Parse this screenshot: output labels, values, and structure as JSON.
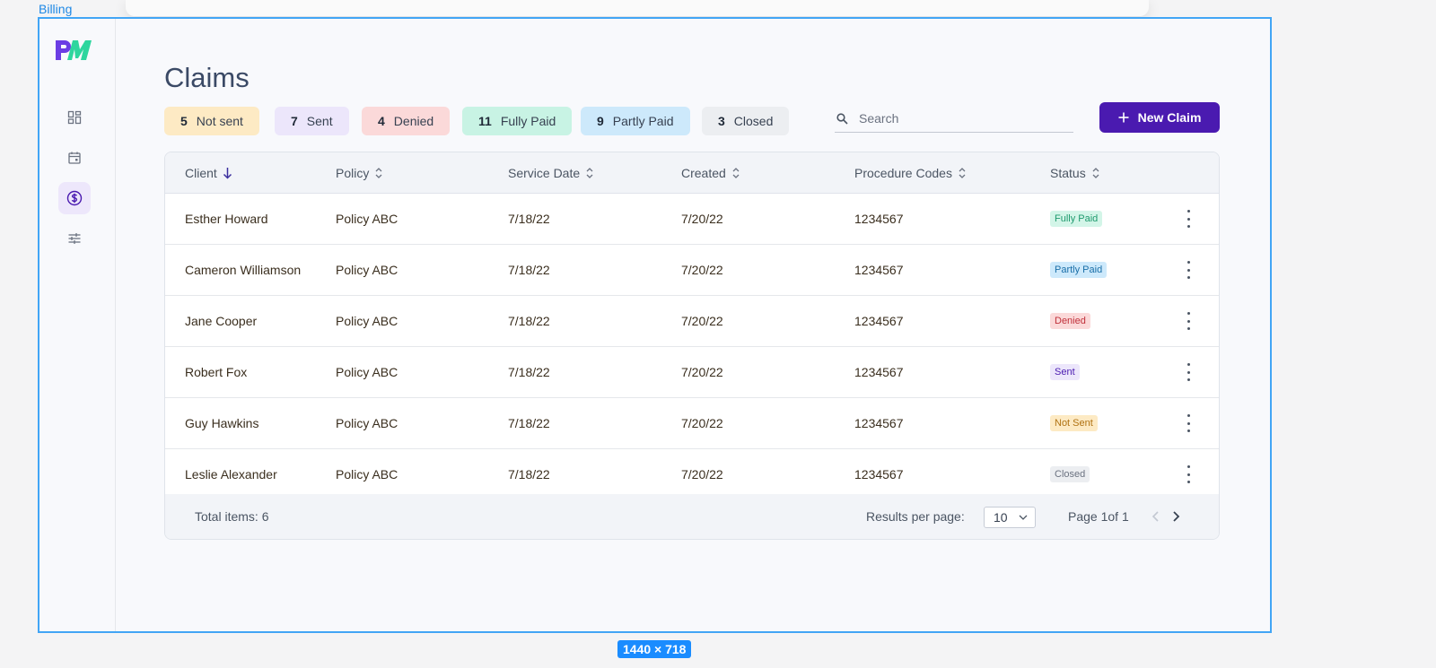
{
  "frame_label": "Billing",
  "size_badge": "1440 × 718",
  "page_title": "Claims",
  "chips": [
    {
      "count": "5",
      "label": "Not sent",
      "bg": "#fdeac4"
    },
    {
      "count": "7",
      "label": "Sent",
      "bg": "#ece6fb"
    },
    {
      "count": "4",
      "label": "Denied",
      "bg": "#fbd9d9"
    },
    {
      "count": "11",
      "label": "Fully Paid",
      "bg": "#c8f3e4"
    },
    {
      "count": "9",
      "label": "Partly Paid",
      "bg": "#cde9fb"
    },
    {
      "count": "3",
      "label": "Closed",
      "bg": "#eceef1"
    }
  ],
  "search": {
    "placeholder": "Search"
  },
  "new_claim_label": "New Claim",
  "table": {
    "columns": [
      "Client",
      "Policy",
      "Service Date",
      "Created",
      "Procedure Codes",
      "Status"
    ],
    "rows": [
      {
        "client": "Esther Howard",
        "policy": "Policy ABC",
        "service_date": "7/18/22",
        "created": "7/20/22",
        "codes": "1234567",
        "status": "Fully Paid"
      },
      {
        "client": "Cameron Williamson",
        "policy": "Policy ABC",
        "service_date": "7/18/22",
        "created": "7/20/22",
        "codes": "1234567",
        "status": "Partly Paid"
      },
      {
        "client": "Jane Cooper",
        "policy": "Policy ABC",
        "service_date": "7/18/22",
        "created": "7/20/22",
        "codes": "1234567",
        "status": "Denied"
      },
      {
        "client": "Robert Fox",
        "policy": "Policy ABC",
        "service_date": "7/18/22",
        "created": "7/20/22",
        "codes": "1234567",
        "status": "Sent"
      },
      {
        "client": "Guy Hawkins",
        "policy": "Policy ABC",
        "service_date": "7/18/22",
        "created": "7/20/22",
        "codes": "1234567",
        "status": "Not Sent"
      },
      {
        "client": "Leslie Alexander",
        "policy": "Policy ABC",
        "service_date": "7/18/22",
        "created": "7/20/22",
        "codes": "1234567",
        "status": "Closed"
      }
    ]
  },
  "status_colors": {
    "Fully Paid": {
      "bg": "#d3f5e8",
      "fg": "#1f9a6e"
    },
    "Partly Paid": {
      "bg": "#cde9fb",
      "fg": "#1a6fa8"
    },
    "Denied": {
      "bg": "#fbd9d9",
      "fg": "#c0303a"
    },
    "Sent": {
      "bg": "#ece6fb",
      "fg": "#4a1ab0"
    },
    "Not Sent": {
      "bg": "#fdeac4",
      "fg": "#b07212"
    },
    "Closed": {
      "bg": "#eceef1",
      "fg": "#6b7280"
    }
  },
  "footer": {
    "total": "Total items: 6",
    "rpp_label": "Results per page:",
    "rpp_value": "10",
    "page_info": "Page 1of 1"
  },
  "nav_icons": [
    "dashboard-icon",
    "calendar-icon",
    "billing-dollar-icon",
    "settings-sliders-icon"
  ],
  "accent": "#4a1ab0"
}
